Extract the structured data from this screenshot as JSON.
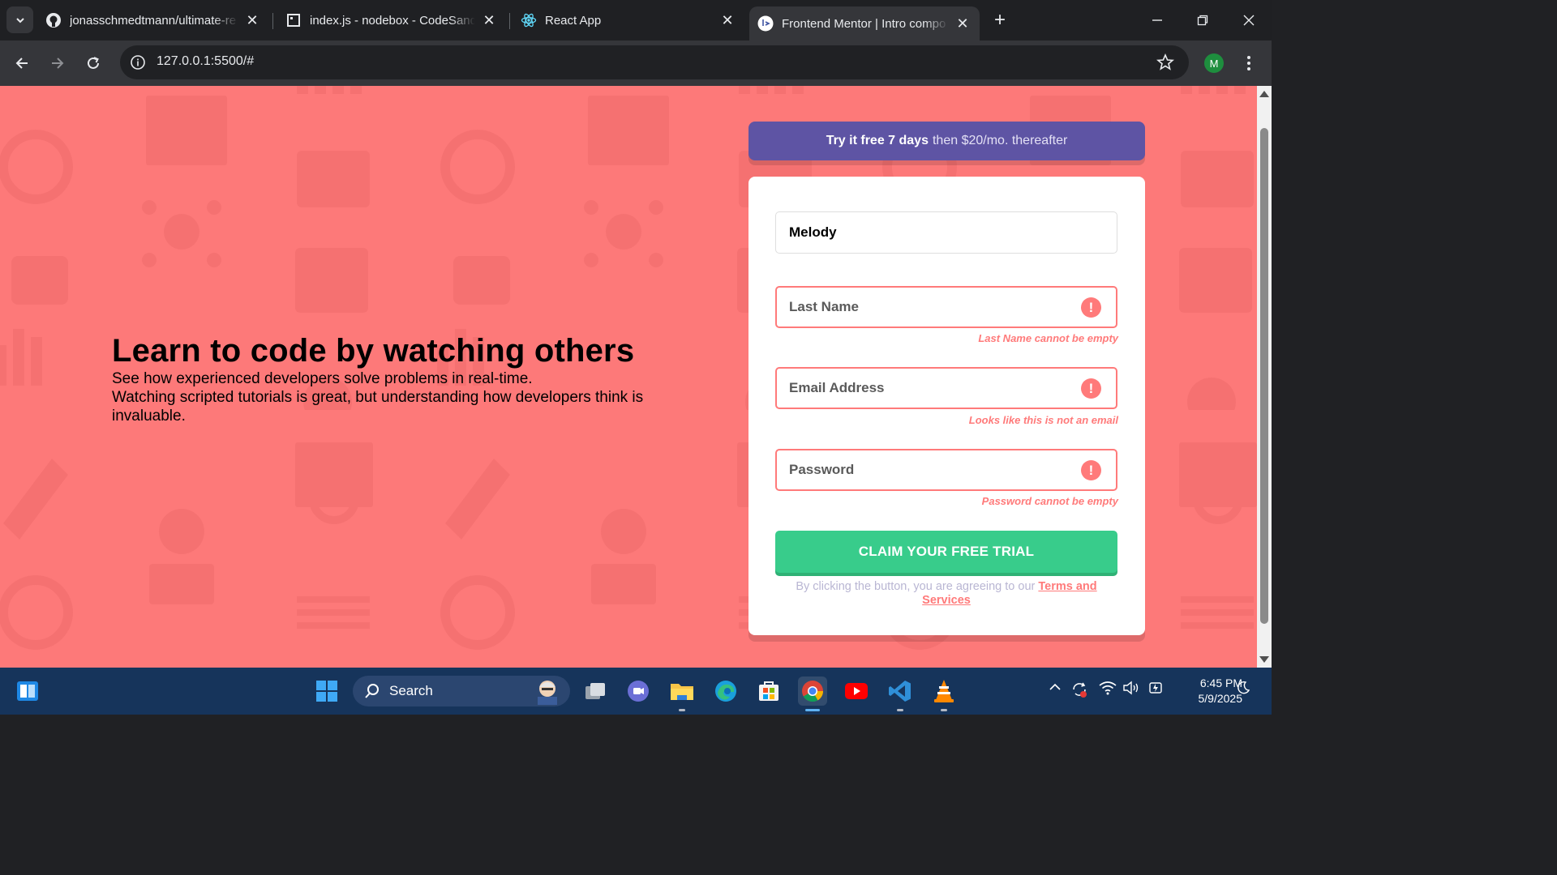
{
  "browser": {
    "tabs": [
      {
        "title": "jonasschmedtmann/ultimate-re",
        "icon": "github-icon"
      },
      {
        "title": "index.js - nodebox - CodeSandb",
        "icon": "codesandbox-icon"
      },
      {
        "title": "React App",
        "icon": "react-icon"
      },
      {
        "title": "Frontend Mentor | Intro compo",
        "icon": "frontend-mentor-icon",
        "active": true
      }
    ],
    "url": "127.0.0.1:5500/#",
    "profile_initial": "M"
  },
  "hero": {
    "title": "Learn to code by watching others",
    "line1": "See how experienced developers solve problems in real-time.",
    "line2": "Watching scripted tutorials is great, but understanding how developers think is invaluable."
  },
  "promo": {
    "bold": "Try it free 7 days",
    "rest": "then $20/mo. thereafter"
  },
  "form": {
    "first_name_value": "Melody",
    "last_name_placeholder": "Last Name",
    "last_name_error": "Last Name cannot be empty",
    "email_placeholder": "Email Address",
    "email_error": "Looks like this is not an email",
    "password_placeholder": "Password",
    "password_error": "Password cannot be empty",
    "error_symbol": "!",
    "cta": "CLAIM YOUR FREE TRIAL",
    "terms_text": "By clicking the button, you are agreeing to our",
    "terms_link": "Terms and Services"
  },
  "taskbar": {
    "search_label": "Search",
    "time": "6:45 PM",
    "date": "5/9/2025"
  },
  "colors": {
    "page_bg": "#fd7979",
    "promo_bg": "#5e54a4",
    "cta_bg": "#38cc8b",
    "error": "#ff7a7a"
  }
}
